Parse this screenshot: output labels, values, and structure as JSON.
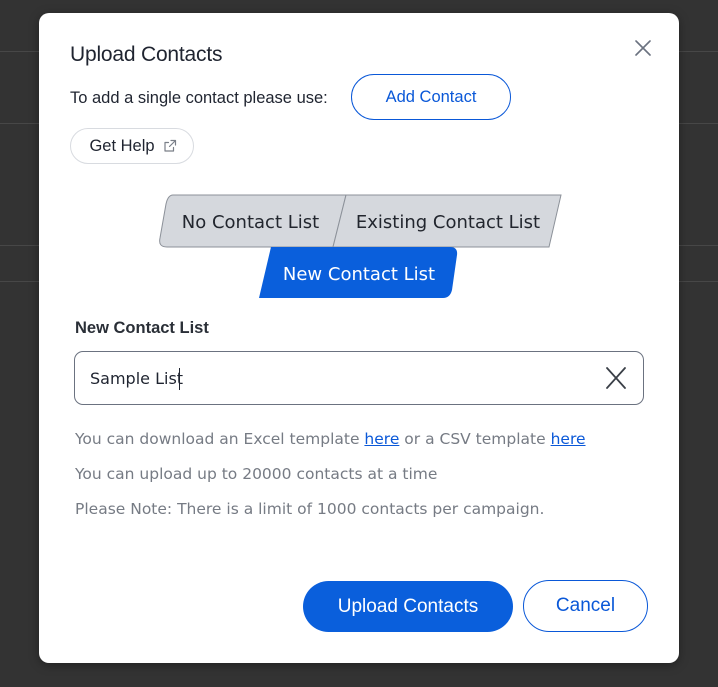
{
  "colors": {
    "primary": "#0a5fdc",
    "segment_inactive": "#d5d8dd",
    "segment_active": "#0a5fdc",
    "link": "#0a58d8",
    "muted_text": "#767b84"
  },
  "modal": {
    "title": "Upload Contacts",
    "close_icon": "close-icon",
    "single_contact_text": "To add a single contact please use:",
    "add_contact_label": "Add Contact",
    "get_help_label": "Get Help",
    "get_help_icon": "external-link-icon"
  },
  "segments": {
    "items": [
      {
        "label": "No Contact List",
        "active": false
      },
      {
        "label": "Existing Contact List",
        "active": false
      },
      {
        "label": "New Contact List",
        "active": true
      }
    ]
  },
  "form": {
    "label": "New Contact List",
    "input_value": "Sample List",
    "clear_icon": "clear-icon"
  },
  "info": {
    "line1_prefix": "You can download an Excel template ",
    "excel_link": "here",
    "line1_middle": " or a CSV template ",
    "csv_link": "here",
    "line2": "You can upload up to 20000 contacts at a time",
    "line3": "Please Note: There is a limit of 1000 contacts per campaign."
  },
  "footer": {
    "upload_label": "Upload Contacts",
    "cancel_label": "Cancel"
  }
}
